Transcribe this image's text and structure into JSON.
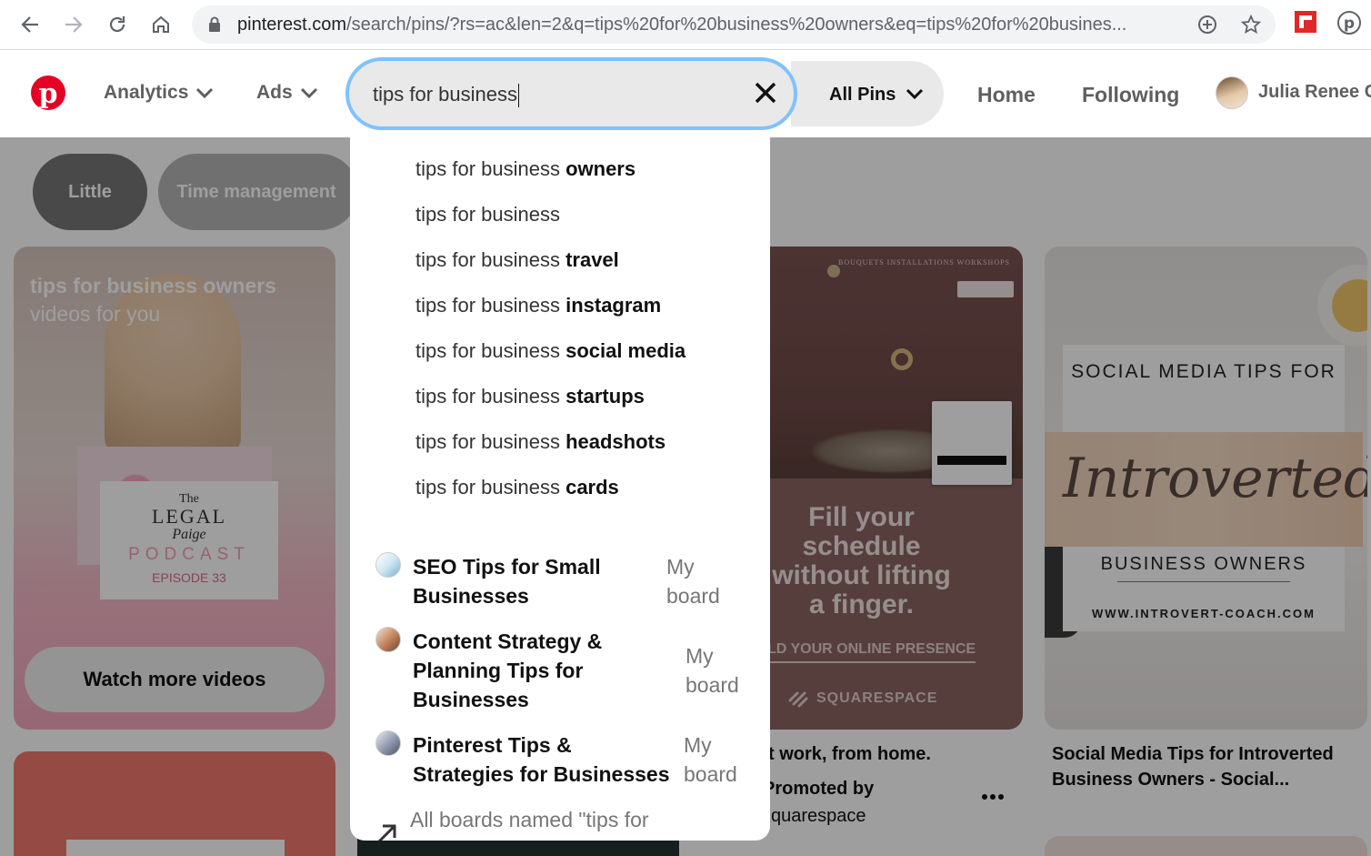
{
  "browser": {
    "url_host": "pinterest.com",
    "url_path": "/search/pins/?rs=ac&len=2&q=tips%20for%20business%20owners&eq=tips%20for%20busines..."
  },
  "header": {
    "analytics": "Analytics",
    "ads": "Ads",
    "search_value": "tips for business",
    "scope": "All Pins",
    "home": "Home",
    "following": "Following",
    "user_name": "Julia Renee C"
  },
  "chips": [
    "Little",
    "Time management"
  ],
  "suggestions": [
    {
      "base": "tips for business ",
      "bold": "owners"
    },
    {
      "base": "tips for business",
      "bold": ""
    },
    {
      "base": "tips for business ",
      "bold": "travel"
    },
    {
      "base": "tips for business ",
      "bold": "instagram"
    },
    {
      "base": "tips for business ",
      "bold": "social media"
    },
    {
      "base": "tips for business ",
      "bold": "startups"
    },
    {
      "base": "tips for business ",
      "bold": "headshots"
    },
    {
      "base": "tips for business ",
      "bold": "cards"
    }
  ],
  "boards": [
    {
      "title": "SEO Tips for Small Businesses",
      "sub": "My board"
    },
    {
      "title": "Content Strategy & Planning Tips for Businesses",
      "sub": "My board"
    },
    {
      "title": "Pinterest Tips & Strategies for Businesses",
      "sub": "My board"
    }
  ],
  "all_boards": "All boards named \"tips for business\"",
  "pins": {
    "video_title": "tips for business owners",
    "video_sub": "videos for you",
    "podcast_the": "The",
    "podcast_legal": "LEGAL",
    "podcast_paige": "Paige",
    "podcast_word": "PODCAST",
    "podcast_episode": "EPISODE 33",
    "watch_more": "Watch more videos",
    "sq_top": "BOUQUETS  INSTALLATIONS  WORKSHOPS",
    "sq_headline": "Fill your schedule without lifting a finger.",
    "sq_cta": "LD YOUR ONLINE PRESENCE",
    "sq_brand": "SQUARESPACE",
    "sq_caption": "t work, from home.",
    "sq_promoted": "Promoted by",
    "sq_promoter": "quarespace",
    "intro_top": "SOCIAL MEDIA TIPS FOR",
    "intro_script": "Introverted",
    "intro_mid": "BUSINESS OWNERS",
    "intro_url": "WWW.INTROVERT-COACH.COM",
    "intro_caption": "Social Media Tips for Introverted Business Owners - Social..."
  }
}
